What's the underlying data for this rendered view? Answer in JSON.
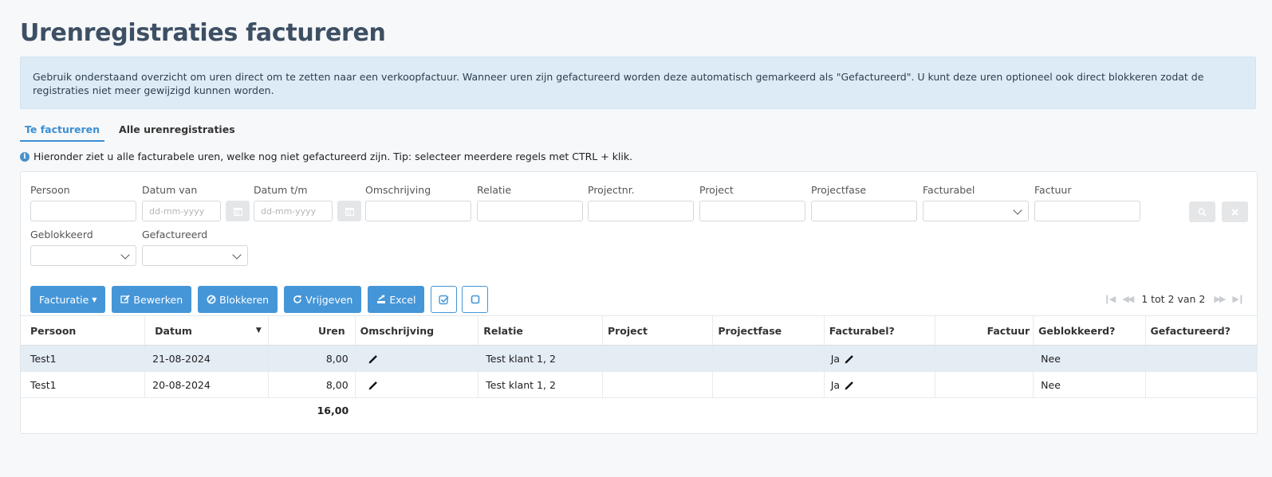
{
  "page": {
    "title": "Urenregistraties factureren"
  },
  "info": "Gebruik onderstaand overzicht om uren direct om te zetten naar een verkoopfactuur. Wanneer uren zijn gefactureerd worden deze automatisch gemarkeerd als \"Gefactureerd\". U kunt deze uren optioneel ook direct blokkeren zodat de registraties niet meer gewijzigd kunnen worden.",
  "tabs": [
    {
      "label": "Te factureren",
      "active": true
    },
    {
      "label": "Alle urenregistraties",
      "active": false
    }
  ],
  "hint": "Hieronder ziet u alle facturabele uren, welke nog niet gefactureerd zijn. Tip: selecteer meerdere regels met CTRL + klik.",
  "filters": {
    "persoon": "Persoon",
    "datum_van": "Datum van",
    "datum_tm": "Datum t/m",
    "date_placeholder": "dd-mm-yyyy",
    "omschrijving": "Omschrijving",
    "relatie": "Relatie",
    "projectnr": "Projectnr.",
    "project": "Project",
    "projectfase": "Projectfase",
    "facturabel": "Facturabel",
    "factuur": "Factuur",
    "geblokkeerd": "Geblokkeerd",
    "gefactureerd": "Gefactureerd"
  },
  "toolbar": {
    "facturatie": "Facturatie",
    "bewerken": "Bewerken",
    "blokkeren": "Blokkeren",
    "vrijgeven": "Vrijgeven",
    "excel": "Excel"
  },
  "pager": {
    "text": "1 tot 2 van 2"
  },
  "table": {
    "headers": [
      "Persoon",
      "Datum",
      "Uren",
      "Omschrijving",
      "Relatie",
      "Project",
      "Projectfase",
      "Facturabel?",
      "Factuur",
      "Geblokkeerd?",
      "Gefactureerd?"
    ],
    "rows": [
      {
        "persoon": "Test1",
        "datum": "21-08-2024",
        "uren": "8,00",
        "relatie": "Test klant 1, 2",
        "facturabel": "Ja",
        "geblokkeerd": "Nee"
      },
      {
        "persoon": "Test1",
        "datum": "20-08-2024",
        "uren": "8,00",
        "relatie": "Test klant 1, 2",
        "facturabel": "Ja",
        "geblokkeerd": "Nee"
      }
    ],
    "total": "16,00"
  },
  "colors": {
    "accent": "#4596d8",
    "info_bg": "#dcebf6",
    "title": "#3d4f63"
  }
}
